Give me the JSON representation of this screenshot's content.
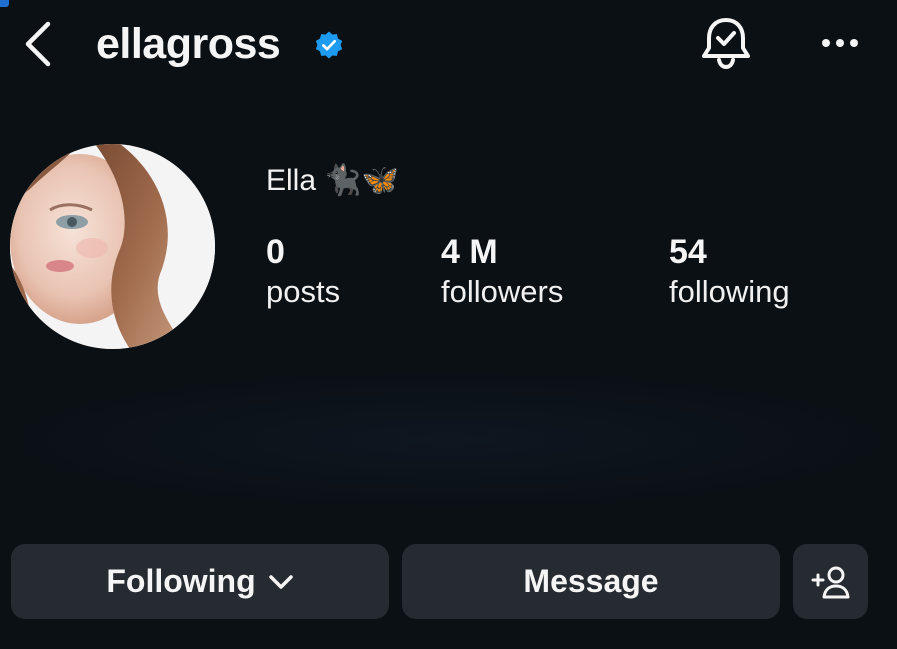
{
  "header": {
    "username": "ellagross",
    "icons": {
      "back": "chevron-left-icon",
      "verified": "verified-badge-icon",
      "notifications": "bell-check-icon",
      "more": "more-horizontal-icon"
    },
    "verified_color": "#1d9bf0"
  },
  "profile": {
    "display_name": "Ella 🐈‍⬛🦋",
    "stats": {
      "posts": {
        "value": "0",
        "label": "posts"
      },
      "followers": {
        "value": "4 M",
        "label": "followers"
      },
      "following": {
        "value": "54",
        "label": "following"
      }
    }
  },
  "actions": {
    "following_label": "Following",
    "message_label": "Message",
    "icons": {
      "following_dropdown": "chevron-down-icon",
      "add_user": "add-person-icon"
    }
  },
  "colors": {
    "background": "#0b1015",
    "button_bg": "#262b31",
    "text": "#f5f5f5"
  }
}
